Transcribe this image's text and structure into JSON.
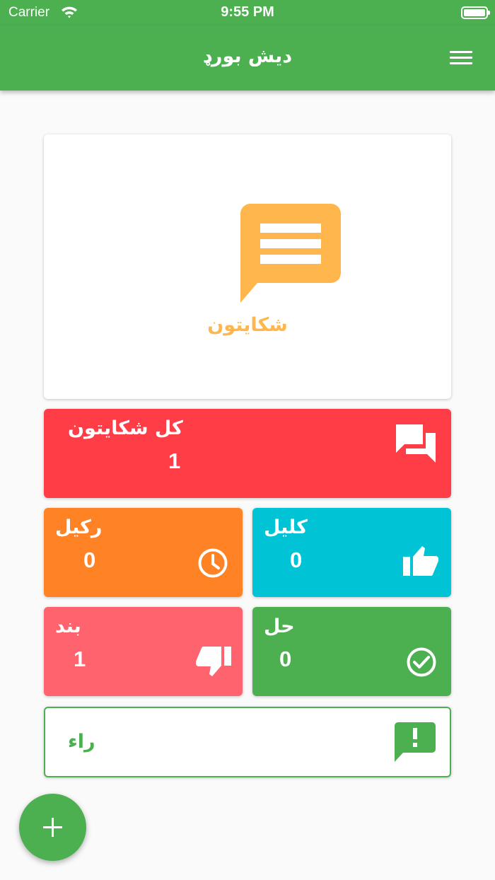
{
  "status_bar": {
    "carrier": "Carrier",
    "time": "9:55 PM"
  },
  "app_bar": {
    "title": "ديش بورډ"
  },
  "hero": {
    "label": "شکايتون"
  },
  "stats": {
    "total": {
      "label": "کل شکايتون",
      "count": "1"
    },
    "pending": {
      "label": "رکيل",
      "count": "0"
    },
    "open": {
      "label": "کليل",
      "count": "0"
    },
    "closed": {
      "label": "بند",
      "count": "1"
    },
    "solved": {
      "label": "حل",
      "count": "0"
    }
  },
  "feedback": {
    "label": "راء"
  },
  "colors": {
    "primary": "#4caf50",
    "hero_accent": "#ffb74d",
    "total": "#ff3d47",
    "pending": "#ff8324",
    "open": "#00c3d5",
    "closed": "#ff636d",
    "solved": "#4caf50"
  },
  "icons": [
    "wifi-icon",
    "battery-icon",
    "menu-icon",
    "chat-list-icon",
    "forum-icon",
    "clock-icon",
    "thumb-up-icon",
    "thumb-down-icon",
    "check-circle-icon",
    "feedback-icon",
    "add-icon"
  ]
}
